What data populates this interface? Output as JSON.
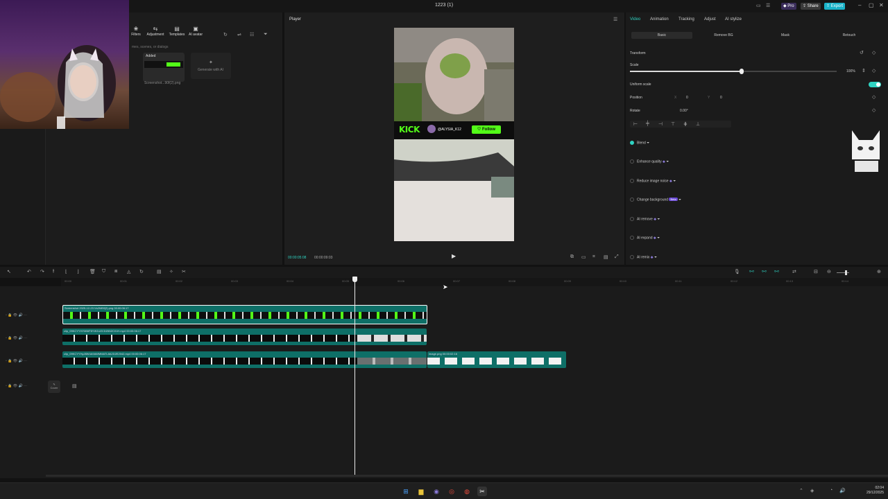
{
  "window": {
    "title": "1223 (1)",
    "pro_label": "Pro",
    "share_label": "Share",
    "export_label": "Export"
  },
  "media": {
    "tabs": [
      {
        "label": "Filters",
        "icon": "filter-icon"
      },
      {
        "label": "Adjustment",
        "icon": "adjust-icon"
      },
      {
        "label": "Templates",
        "icon": "template-icon"
      },
      {
        "label": "AI avatar",
        "icon": "avatar-icon"
      }
    ],
    "search_placeholder": "mes, scenes, or dialogs",
    "card1_badge": "Added",
    "card1_name": "Screenshot...90f(2).png",
    "card2_label": "Generate with AI"
  },
  "player": {
    "label": "Player",
    "current_time": "00:00:05:08",
    "total_time": "00:00:09:03",
    "overlay": {
      "brand": "KICK",
      "handle": "@ALYSIA_K12",
      "follow_label": "Follow"
    }
  },
  "props": {
    "tabs": [
      "Video",
      "Animation",
      "Tracking",
      "Adjust",
      "AI stylize"
    ],
    "active_tab": "Video",
    "subtabs": [
      "Basic",
      "Remove BG",
      "Mask",
      "Retouch"
    ],
    "transform_label": "Transform",
    "scale_label": "Scale",
    "scale_value": "100%",
    "scale_fraction": 0.54,
    "uniform_scale_label": "Uniform scale",
    "position_label": "Position",
    "pos_x_prefix": "X",
    "pos_x": "0",
    "pos_y_prefix": "Y",
    "pos_y": "0",
    "rotate_label": "Rotate",
    "rotate_value": "0.00°",
    "sections": [
      {
        "label": "Blend",
        "checked": true
      },
      {
        "label": "Enhance quality",
        "checked": false
      },
      {
        "label": "Reduce image noise",
        "checked": false
      },
      {
        "label": "Change background",
        "checked": false,
        "badge": "Beta"
      },
      {
        "label": "AI remove",
        "checked": false
      },
      {
        "label": "AI expand",
        "checked": false
      },
      {
        "label": "AI remix",
        "checked": false
      }
    ]
  },
  "timeline": {
    "ticks": [
      "00:00",
      "00:01",
      "00:02",
      "00:03",
      "00:04",
      "00:05",
      "00:06",
      "00:07",
      "00:08",
      "00:09",
      "00:10",
      "00:11",
      "00:12",
      "00:13",
      "00:14"
    ],
    "clips": [
      {
        "label": "Screenshot 2025-12-23 Vs2f4f0f(2).png   00:00:06:17"
      },
      {
        "label": "clip_09KCYYHYMWF8YW1UZCDZ65ZC01H.mp4   00:00:06:17"
      },
      {
        "label": "clip_09KCYYHyJ8W4A9AWMMATL8A2D2E2042.mp4   00:00:06:17"
      },
      {
        "label": "image.png   00:00:02:16"
      }
    ],
    "cover_label": "Cover"
  },
  "taskbar": {
    "time": "02:04",
    "date": "29/12/2025"
  },
  "colors": {
    "accent": "#2fd3c2",
    "kick_green": "#53fc18",
    "track_teal": "#0e6f67"
  }
}
